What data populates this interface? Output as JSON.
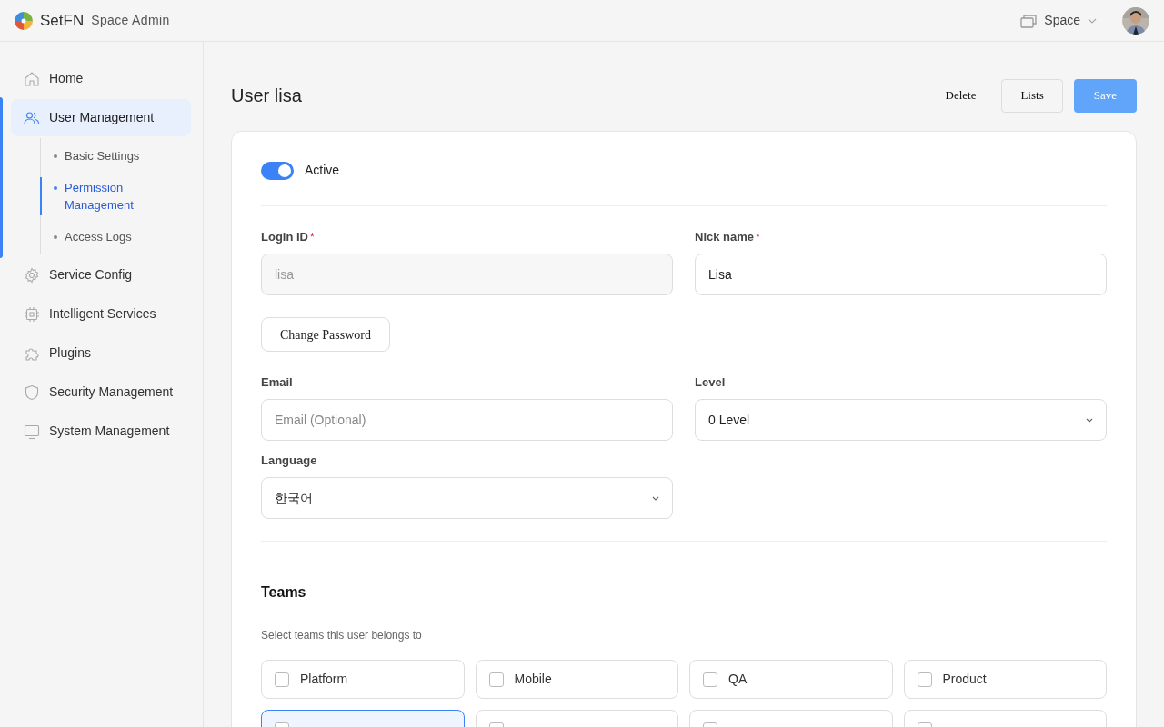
{
  "header": {
    "brand": "SetFN",
    "app_title": "Space Admin",
    "space_label": "Space"
  },
  "sidebar": {
    "items": [
      {
        "label": "Home",
        "selected": false
      },
      {
        "label": "User Management",
        "selected": true,
        "expanded": true,
        "children": [
          {
            "label": "Basic Settings",
            "selected": false
          },
          {
            "label": "Permission Management",
            "selected": true
          },
          {
            "label": "Access Logs",
            "selected": false
          }
        ]
      },
      {
        "label": "Service Config",
        "selected": false
      },
      {
        "label": "Intelligent Services",
        "selected": false
      },
      {
        "label": "Plugins",
        "selected": false
      },
      {
        "label": "Security Management",
        "selected": false
      },
      {
        "label": "System Management",
        "selected": false
      }
    ]
  },
  "page": {
    "title": "User lisa",
    "actions": [
      {
        "label": "Delete",
        "kind": "text"
      },
      {
        "label": "Lists",
        "kind": "outline"
      },
      {
        "label": "Save",
        "kind": "primary"
      }
    ]
  },
  "form": {
    "active": {
      "label": "Active",
      "on": true
    },
    "login_id": {
      "label": "Login ID",
      "required_mark": "*",
      "value": "lisa",
      "disabled": true
    },
    "nick_name": {
      "label": "Nick name",
      "required_mark": "*",
      "value": "Lisa"
    },
    "change_password": "Change Password",
    "email": {
      "label": "Email",
      "placeholder": "Email (Optional)"
    },
    "level": {
      "label": "Level",
      "value": "0 Level"
    },
    "language": {
      "label": "Language",
      "value": "한국어"
    }
  },
  "teams": {
    "title": "Teams",
    "hint": "Select teams this user belongs to",
    "items": [
      {
        "label": "Platform",
        "checked": false,
        "selected": false
      },
      {
        "label": "Mobile",
        "checked": false,
        "selected": false
      },
      {
        "label": "QA",
        "checked": false,
        "selected": false
      },
      {
        "label": "Product",
        "checked": false,
        "selected": false
      },
      {
        "checked": false,
        "selected": true
      },
      {
        "checked": false,
        "selected": false
      },
      {
        "checked": false,
        "selected": false
      },
      {
        "checked": false,
        "selected": false
      }
    ]
  }
}
